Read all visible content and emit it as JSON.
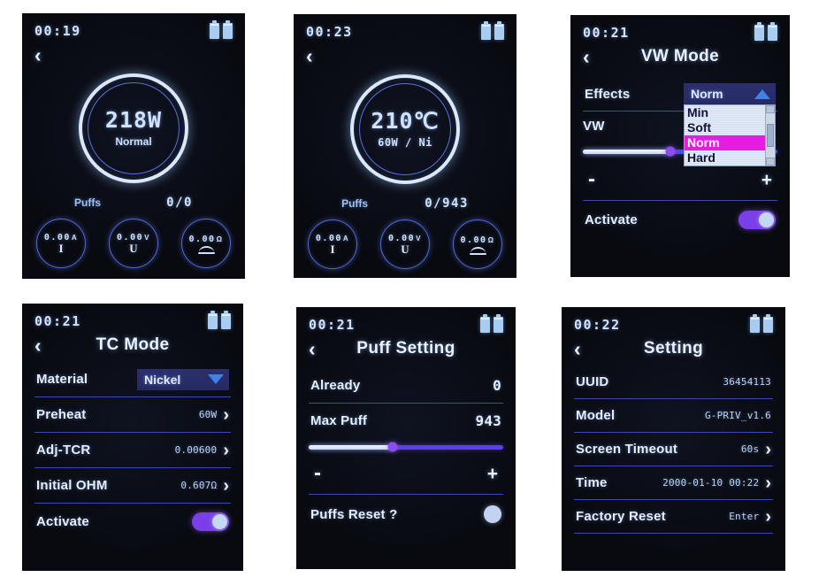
{
  "meta": {
    "layout": "3x2 grid of device screenshots",
    "accent_purple": "#7a3fe8",
    "accent_blue": "#3d82e8",
    "highlight_magenta": "#e81ce0",
    "divider_blue": "#3b49b4",
    "text_blue": "#cfe2ff",
    "screen_bg": "#080a10",
    "page_bg": "#ffffff"
  },
  "screens": [
    {
      "id": "vw-main",
      "name": "vw-main-screen",
      "statusbar": {
        "clock": "00:19",
        "battery_count": 2
      },
      "back_icon": "‹",
      "gauge": {
        "value": "218W",
        "sub": "Normal"
      },
      "puffs": {
        "label": "Puffs",
        "value": "0/0"
      },
      "meters": [
        {
          "value": "0.00",
          "unit": "A",
          "symbol": "I",
          "icon": "current-icon"
        },
        {
          "value": "0.00",
          "unit": "V",
          "symbol": "U",
          "icon": "voltage-icon"
        },
        {
          "value": "0.00",
          "unit": "Ω",
          "symbol": "",
          "icon": "coil-icon"
        }
      ]
    },
    {
      "id": "tc-main",
      "name": "tc-main-screen",
      "statusbar": {
        "clock": "00:23",
        "battery_count": 2
      },
      "back_icon": "‹",
      "gauge": {
        "value": "210℃",
        "sub": "60W / Ni"
      },
      "puffs": {
        "label": "Puffs",
        "value": "0/943"
      },
      "meters": [
        {
          "value": "0.00",
          "unit": "A",
          "symbol": "I",
          "icon": "current-icon"
        },
        {
          "value": "0.00",
          "unit": "V",
          "symbol": "U",
          "icon": "voltage-icon"
        },
        {
          "value": "0.00",
          "unit": "Ω",
          "symbol": "",
          "icon": "coil-icon"
        }
      ]
    },
    {
      "id": "vw-mode",
      "name": "vw-mode-screen",
      "statusbar": {
        "clock": "00:21",
        "battery_count": 2
      },
      "back_icon": "‹",
      "title": "VW Mode",
      "effects": {
        "label": "Effects",
        "selected": "Norm",
        "caret": "caret-up-icon",
        "options": [
          "Min",
          "Soft",
          "Norm",
          "Hard"
        ],
        "selected_index": 2,
        "expanded": true
      },
      "vw": {
        "label": "VW",
        "slider_percent": 45,
        "minus": "-",
        "plus": "+"
      },
      "activate": {
        "label": "Activate",
        "state": "on"
      }
    },
    {
      "id": "tc-mode",
      "name": "tc-mode-screen",
      "statusbar": {
        "clock": "00:21",
        "battery_count": 2
      },
      "back_icon": "‹",
      "title": "TC Mode",
      "rows": [
        {
          "label": "Material",
          "value": "Nickel",
          "control": "select",
          "caret": "caret-down-icon"
        },
        {
          "label": "Preheat",
          "value": "60W",
          "control": "chevron"
        },
        {
          "label": "Adj-TCR",
          "value": "0.00600",
          "control": "chevron"
        },
        {
          "label": "Initial OHM",
          "value": "0.607Ω",
          "control": "chevron"
        }
      ],
      "activate": {
        "label": "Activate",
        "state": "on"
      }
    },
    {
      "id": "puff-setting",
      "name": "puff-setting-screen",
      "statusbar": {
        "clock": "00:21",
        "battery_count": 2
      },
      "back_icon": "‹",
      "title": "Puff Setting",
      "already": {
        "label": "Already",
        "value": "0"
      },
      "max_puff": {
        "label": "Max Puff",
        "value": "943",
        "slider_percent": 43,
        "minus": "-",
        "plus": "+"
      },
      "puffs_reset": {
        "label": "Puffs Reset ?",
        "control": "dot-button"
      }
    },
    {
      "id": "setting",
      "name": "setting-screen",
      "statusbar": {
        "clock": "00:22",
        "battery_count": 2
      },
      "back_icon": "‹",
      "title": "Setting",
      "rows": [
        {
          "label": "UUID",
          "value": "36454113",
          "control": "none"
        },
        {
          "label": "Model",
          "value": "G-PRIV_v1.6",
          "control": "none"
        },
        {
          "label": "Screen Timeout",
          "value": "60s",
          "control": "chevron"
        },
        {
          "label": "Time",
          "value": "2000-01-10 00:22",
          "control": "chevron"
        },
        {
          "label": "Factory Reset",
          "value": "Enter",
          "control": "chevron"
        }
      ]
    }
  ]
}
